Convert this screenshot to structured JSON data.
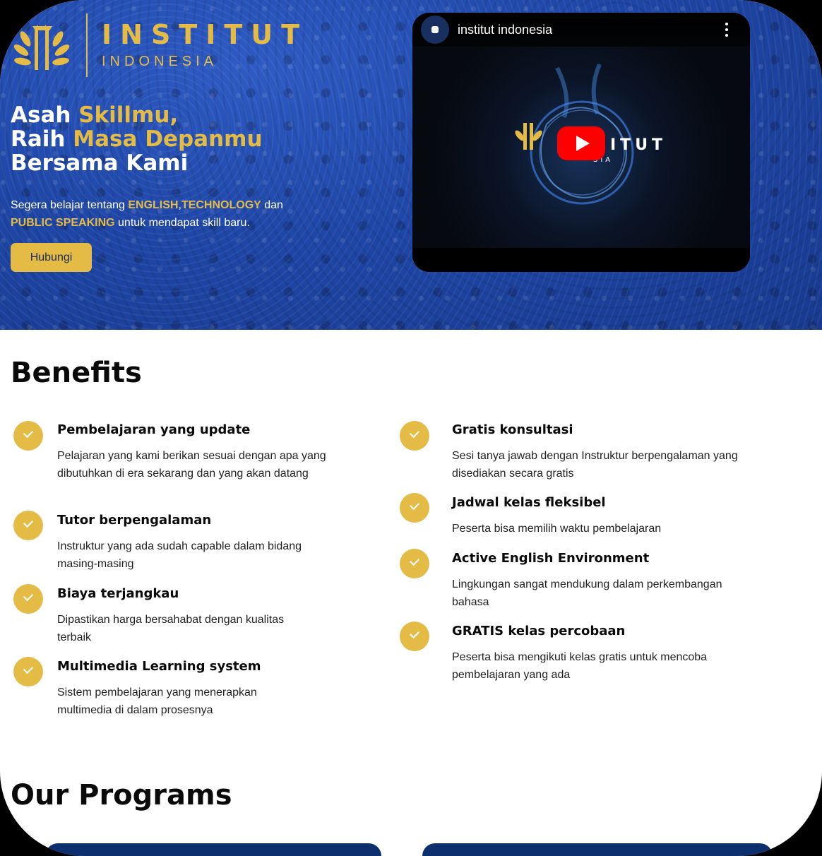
{
  "brand": {
    "name": "INSTITUT",
    "subtitle": "INDONESIA",
    "gold": "#e4bc45",
    "blue": "#1f47a8"
  },
  "hero": {
    "headline": {
      "l1a": "Asah ",
      "l1b": "Skillmu,",
      "l2a": "Raih ",
      "l2b": "Masa Depanmu",
      "l3": "Bersama Kami"
    },
    "desc": {
      "p1": "Segera belajar tentang ",
      "k1": "ENGLISH",
      "p2": ",",
      "k2": "TECHNOLOGY",
      "p3": " dan",
      "k3": "PUBLIC SPEAKING",
      "p4": " untuk mendapat skill baru."
    },
    "cta_label": "Hubungi"
  },
  "video": {
    "channel_title": "institut indonesia",
    "overlay_text": "ITUT",
    "overlay_sub": "SIA"
  },
  "benefits": {
    "title": "Benefits",
    "left": [
      {
        "title": "Pembelajaran yang update",
        "desc": "Pelajaran yang kami berikan sesuai dengan apa yang dibutuhkan di era sekarang dan yang akan datang"
      },
      {
        "title": "Tutor berpengalaman",
        "desc": "Instruktur yang ada sudah capable dalam bidang masing-masing"
      },
      {
        "title": "Biaya terjangkau",
        "desc": "Dipastikan harga bersahabat dengan kualitas terbaik"
      },
      {
        "title": "Multimedia Learning system",
        "desc": "Sistem pembelajaran yang menerapkan multimedia di dalam prosesnya"
      }
    ],
    "right": [
      {
        "title": "Gratis konsultasi",
        "desc": "Sesi tanya jawab dengan Instruktur berpengalaman yang disediakan secara gratis"
      },
      {
        "title": "Jadwal kelas fleksibel",
        "desc": "Peserta bisa memilih waktu pembelajaran"
      },
      {
        "title": "Active English Environment",
        "desc": "Lingkungan sangat mendukung dalam perkembangan bahasa"
      },
      {
        "title": "GRATIS kelas percobaan",
        "desc": "Peserta bisa mengikuti kelas gratis untuk mencoba pembelajaran yang ada"
      }
    ]
  },
  "programs": {
    "title": "Our Programs"
  }
}
